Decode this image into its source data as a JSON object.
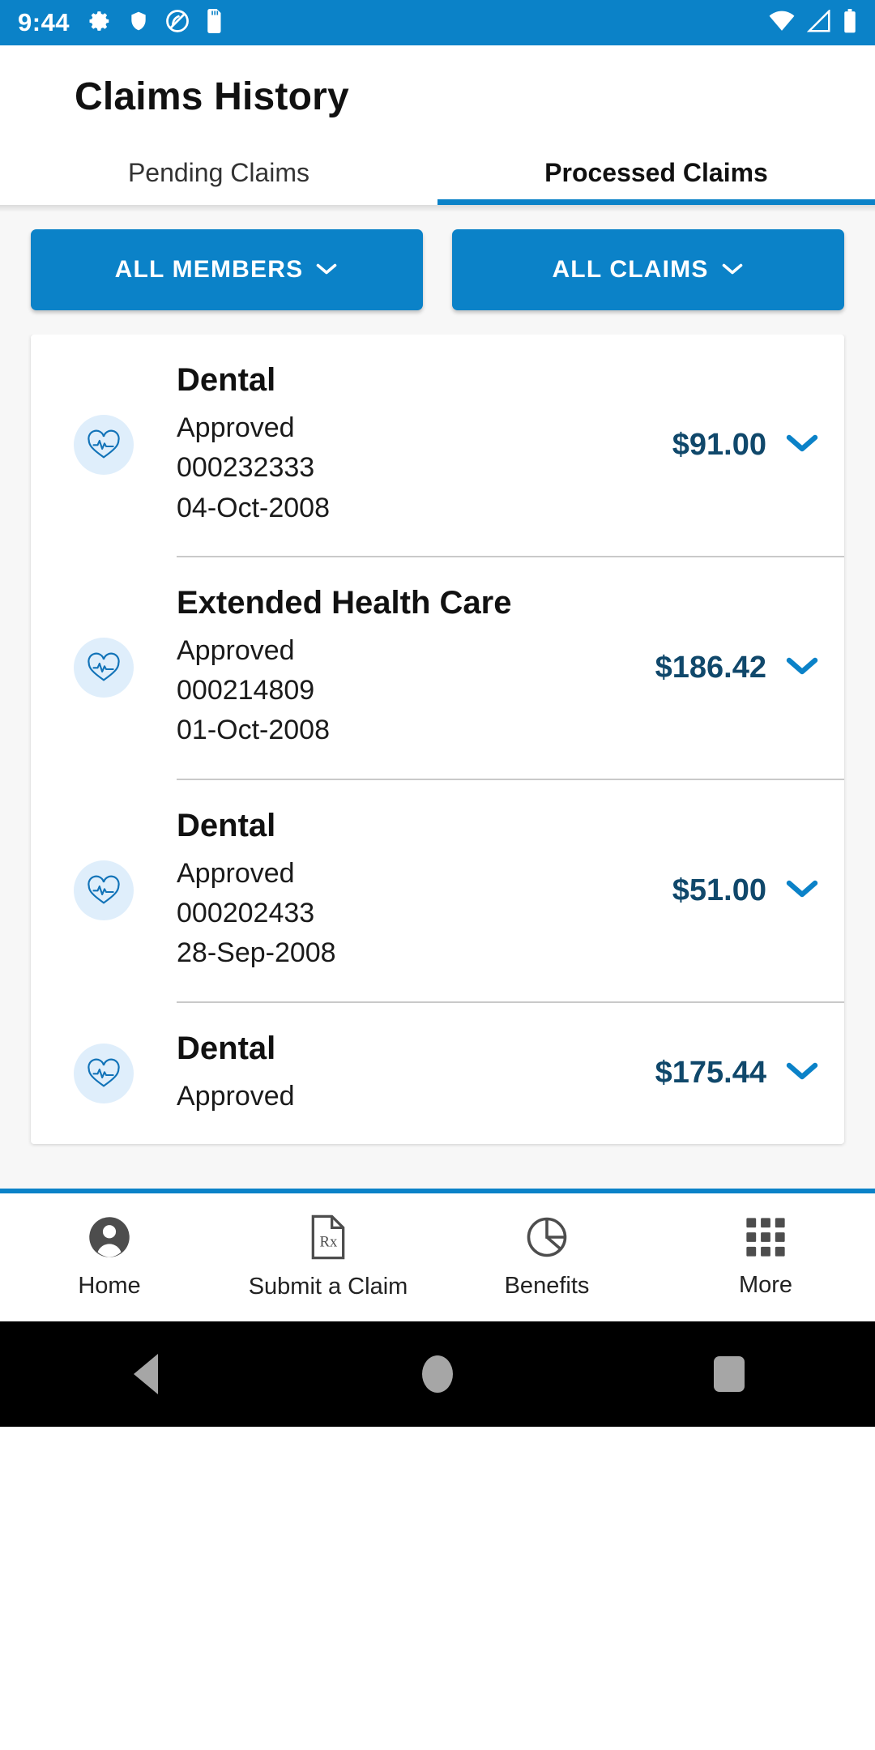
{
  "status_bar": {
    "time": "9:44",
    "left_icons": [
      "gear-icon",
      "shield-icon",
      "do-not-disturb-icon",
      "sd-card-icon"
    ],
    "right_icons": [
      "wifi-icon",
      "cellular-signal-icon",
      "battery-icon"
    ],
    "background_color": "#0B82C8"
  },
  "header": {
    "title": "Claims History"
  },
  "tabs": [
    {
      "label": "Pending Claims",
      "active": false
    },
    {
      "label": "Processed Claims",
      "active": true
    }
  ],
  "filters": [
    {
      "label": "ALL MEMBERS",
      "icon": "chevron-down-icon"
    },
    {
      "label": "ALL CLAIMS",
      "icon": "chevron-down-icon"
    }
  ],
  "claims": [
    {
      "icon": "heart-pulse-icon",
      "type": "Dental",
      "status": "Approved",
      "claim_number": "000232333",
      "date": "04-Oct-2008",
      "amount": "$91.00",
      "expand_icon": "chevron-down-icon"
    },
    {
      "icon": "heart-pulse-icon",
      "type": "Extended Health Care",
      "status": "Approved",
      "claim_number": "000214809",
      "date": "01-Oct-2008",
      "amount": "$186.42",
      "expand_icon": "chevron-down-icon"
    },
    {
      "icon": "heart-pulse-icon",
      "type": "Dental",
      "status": "Approved",
      "claim_number": "000202433",
      "date": "28-Sep-2008",
      "amount": "$51.00",
      "expand_icon": "chevron-down-icon"
    },
    {
      "icon": "heart-pulse-icon",
      "type": "Dental",
      "status": "Approved",
      "claim_number": "",
      "date": "",
      "amount": "$175.44",
      "expand_icon": "chevron-down-icon"
    }
  ],
  "bottom_nav": [
    {
      "label": "Home",
      "icon": "person-icon"
    },
    {
      "label": "Submit a Claim",
      "icon": "prescription-document-icon"
    },
    {
      "label": "Benefits",
      "icon": "pie-chart-icon"
    },
    {
      "label": "More",
      "icon": "grid-apps-icon"
    }
  ],
  "android_nav": {
    "back": "back-triangle-icon",
    "home": "home-circle-icon",
    "recents": "recents-square-icon"
  },
  "colors": {
    "brand_blue": "#0B82C8",
    "amount_navy": "#10486B",
    "page_bg": "#F7F7F7",
    "icon_bg": "#DFEEFB"
  }
}
